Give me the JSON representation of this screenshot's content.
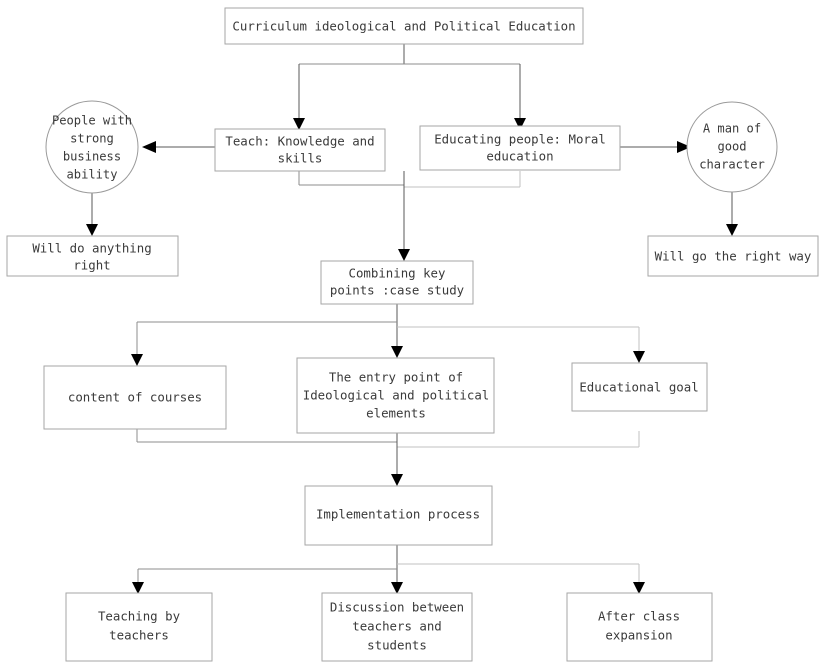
{
  "diagram": {
    "title": "Curriculum ideological and Political Education flowchart",
    "type": "flowchart",
    "background_color": "#ffffff",
    "box_border_color": "#a6a6a6",
    "connector_color": "#8c8c8c",
    "arrowhead_color": "#000000",
    "text_color": "#3a3a3a"
  },
  "nodes": {
    "root": {
      "label": "Curriculum ideological and Political Education",
      "shape": "rect",
      "lines": [
        "Curriculum ideological and Political Education"
      ]
    },
    "teach": {
      "label": "Teach: Knowledge and skills",
      "shape": "rect",
      "lines": [
        "Teach: Knowledge and",
        "skills"
      ]
    },
    "educating": {
      "label": "Educating people: Moral education",
      "shape": "rect",
      "lines": [
        "Educating people: Moral",
        "education"
      ]
    },
    "people_strong": {
      "label": "People with strong business ability",
      "shape": "circle",
      "lines": [
        "People with",
        "strong",
        "business",
        "ability"
      ]
    },
    "man_good": {
      "label": "A man of good character",
      "shape": "circle",
      "lines": [
        "A man of",
        "good",
        "character"
      ]
    },
    "will_do": {
      "label": "Will do anything right",
      "shape": "rect",
      "lines": [
        "Will do anything",
        "right"
      ]
    },
    "will_go": {
      "label": "Will go the right way",
      "shape": "rect",
      "lines": [
        "Will go the right way"
      ]
    },
    "combining": {
      "label": "Combining key points :case study",
      "shape": "rect",
      "lines": [
        "Combining key",
        "points :case study"
      ]
    },
    "content_courses": {
      "label": "content of courses",
      "shape": "rect",
      "lines": [
        "content of courses"
      ]
    },
    "entry_point": {
      "label": "The entry point of Ideological and political elements",
      "shape": "rect",
      "lines": [
        "The entry point of",
        "Ideological and political",
        "elements"
      ]
    },
    "educational_goal": {
      "label": "Educational goal",
      "shape": "rect",
      "lines": [
        "Educational goal"
      ]
    },
    "implementation": {
      "label": "Implementation process",
      "shape": "rect",
      "lines": [
        "Implementation process"
      ]
    },
    "teaching_by": {
      "label": "Teaching by teachers",
      "shape": "rect",
      "lines": [
        "Teaching by",
        "teachers"
      ]
    },
    "discussion": {
      "label": "Discussion between teachers and students",
      "shape": "rect",
      "lines": [
        "Discussion between",
        "teachers and",
        "students"
      ]
    },
    "after_class": {
      "label": "After class expansion",
      "shape": "rect",
      "lines": [
        "After class",
        "expansion"
      ]
    }
  },
  "edges": [
    {
      "from": "root",
      "to": "teach",
      "style": "orthogonal",
      "arrow": "down"
    },
    {
      "from": "root",
      "to": "educating",
      "style": "orthogonal",
      "arrow": "down"
    },
    {
      "from": "teach",
      "to": "people_strong",
      "style": "straight",
      "arrow": "left"
    },
    {
      "from": "educating",
      "to": "man_good",
      "style": "straight",
      "arrow": "right"
    },
    {
      "from": "people_strong",
      "to": "will_do",
      "style": "straight",
      "arrow": "down"
    },
    {
      "from": "man_good",
      "to": "will_go",
      "style": "straight",
      "arrow": "down"
    },
    {
      "from": "teach",
      "to": "combining",
      "style": "orthogonal",
      "arrow": "down"
    },
    {
      "from": "educating",
      "to": "combining",
      "style": "orthogonal",
      "arrow": "down"
    },
    {
      "from": "combining",
      "to": "content_courses",
      "style": "orthogonal",
      "arrow": "down"
    },
    {
      "from": "combining",
      "to": "entry_point",
      "style": "straight",
      "arrow": "down"
    },
    {
      "from": "combining",
      "to": "educational_goal",
      "style": "orthogonal",
      "arrow": "down"
    },
    {
      "from": "content_courses",
      "to": "implementation",
      "style": "orthogonal",
      "arrow": "down"
    },
    {
      "from": "entry_point",
      "to": "implementation",
      "style": "straight",
      "arrow": "down"
    },
    {
      "from": "educational_goal",
      "to": "implementation",
      "style": "orthogonal",
      "arrow": "down"
    },
    {
      "from": "implementation",
      "to": "teaching_by",
      "style": "orthogonal",
      "arrow": "down"
    },
    {
      "from": "implementation",
      "to": "discussion",
      "style": "straight",
      "arrow": "down"
    },
    {
      "from": "implementation",
      "to": "after_class",
      "style": "orthogonal",
      "arrow": "down"
    }
  ]
}
